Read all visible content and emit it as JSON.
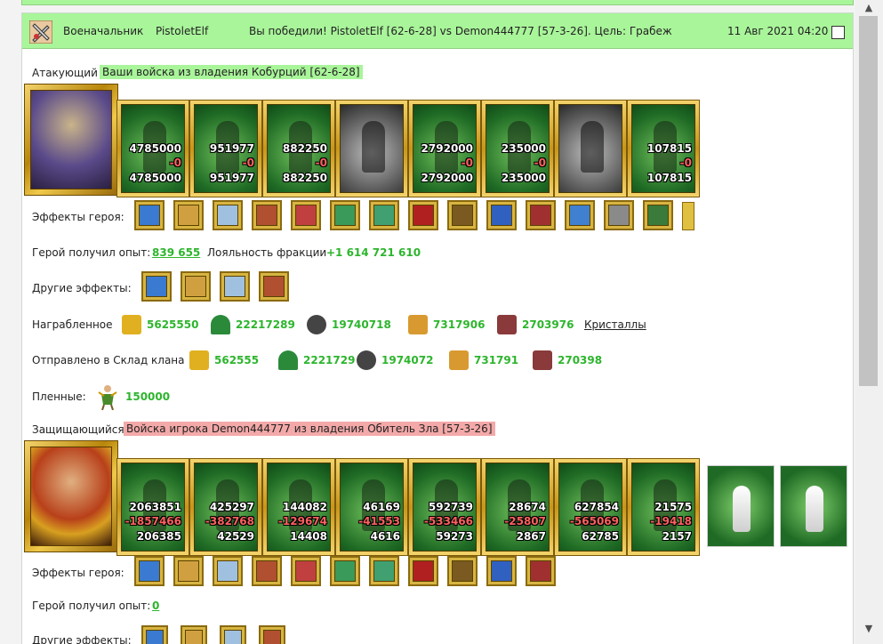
{
  "header": {
    "role": "Военачальник",
    "player": "PistoletElf",
    "result": "Вы победили! PistoletElf [62-6-28] vs Demon444777 [57-3-26]. Цель: Грабеж",
    "date": "11 Авг 2021 04:20"
  },
  "attacker": {
    "label": "Атакующий",
    "banner": "Ваши войска из владения Кобурций [62-6-28]",
    "units": [
      {
        "top": "4785000",
        "loss": "-0",
        "bottom": "4785000",
        "style": "green"
      },
      {
        "top": "951977",
        "loss": "-0",
        "bottom": "951977",
        "style": "green"
      },
      {
        "top": "882250",
        "loss": "-0",
        "bottom": "882250",
        "style": "green"
      },
      {
        "top": "",
        "loss": "",
        "bottom": "",
        "style": "grey"
      },
      {
        "top": "2792000",
        "loss": "-0",
        "bottom": "2792000",
        "style": "green"
      },
      {
        "top": "235000",
        "loss": "-0",
        "bottom": "235000",
        "style": "green"
      },
      {
        "top": "",
        "loss": "",
        "bottom": "",
        "style": "grey"
      },
      {
        "top": "107815",
        "loss": "-0",
        "bottom": "107815",
        "style": "green"
      }
    ],
    "effects_label": "Эффекты героя:",
    "effects": [
      "sword-icon",
      "handshake-icon",
      "fist-icon",
      "tower-icon",
      "dice-icon",
      "shield-icon",
      "shield-hand-icon",
      "xp-icon",
      "star-xp-icon",
      "question-icon",
      "skull-icon",
      "ice-armor-icon",
      "band-icon",
      "boots-icon",
      "arrow-right-icon"
    ],
    "exp_label": "Герой получил опыт:",
    "exp_value": "839 655",
    "loyalty_label": "Лояльность фракции",
    "loyalty_value": "+1 614 721 610",
    "other_label": "Другие эффекты:",
    "other_effects": [
      "xp-badge-icon",
      "fist-sword-icon",
      "gold-bag-icon",
      "sword-icon"
    ],
    "loot_label": "Награбленное",
    "loot": [
      {
        "icon": "gold-icon",
        "value": "5625550"
      },
      {
        "icon": "wood-icon",
        "value": "22217289"
      },
      {
        "icon": "ore-icon",
        "value": "19740718"
      },
      {
        "icon": "wheat-icon",
        "value": "7317906"
      },
      {
        "icon": "stone-icon",
        "value": "2703976"
      }
    ],
    "crystals_link": "Кристаллы",
    "clan_label": "Отправлено в Склад клана",
    "clan": [
      {
        "icon": "gold-icon",
        "value": "562555"
      },
      {
        "icon": "wood-icon",
        "value": "2221729"
      },
      {
        "icon": "ore-icon",
        "value": "1974072"
      },
      {
        "icon": "wheat-icon",
        "value": "731791"
      },
      {
        "icon": "stone-icon",
        "value": "270398"
      }
    ],
    "prisoners_label": "Пленные:",
    "prisoners_value": "150000"
  },
  "defender": {
    "label": "Защищающийся",
    "banner": "Войска игрока Demon444777 из владения Обитель Зла [57-3-26]",
    "units": [
      {
        "top": "2063851",
        "loss": "-1857466",
        "bottom": "206385"
      },
      {
        "top": "425297",
        "loss": "-382768",
        "bottom": "42529"
      },
      {
        "top": "144082",
        "loss": "-129674",
        "bottom": "14408"
      },
      {
        "top": "46169",
        "loss": "-41553",
        "bottom": "4616"
      },
      {
        "top": "592739",
        "loss": "-533466",
        "bottom": "59273"
      },
      {
        "top": "28674",
        "loss": "-25807",
        "bottom": "2867"
      },
      {
        "top": "627854",
        "loss": "-565069",
        "bottom": "62785"
      },
      {
        "top": "21575",
        "loss": "-19418",
        "bottom": "2157"
      }
    ],
    "effects_label": "Эффекты героя:",
    "effects": [
      "book-icon",
      "gears-icon",
      "shield-icon",
      "map-icon",
      "helmet-icon",
      "demon-icon",
      "ring-icon",
      "claw-icon",
      "amulet-icon",
      "staff-icon",
      "armor-icon"
    ],
    "exp_label": "Герой получил опыт:",
    "exp_value": "0",
    "other_label": "Другие эффекты:"
  },
  "colors": {
    "header_green": "#a9f59a",
    "positive": "#2db52d",
    "loss": "#ff6060",
    "gold_frame": "#c9961a"
  }
}
